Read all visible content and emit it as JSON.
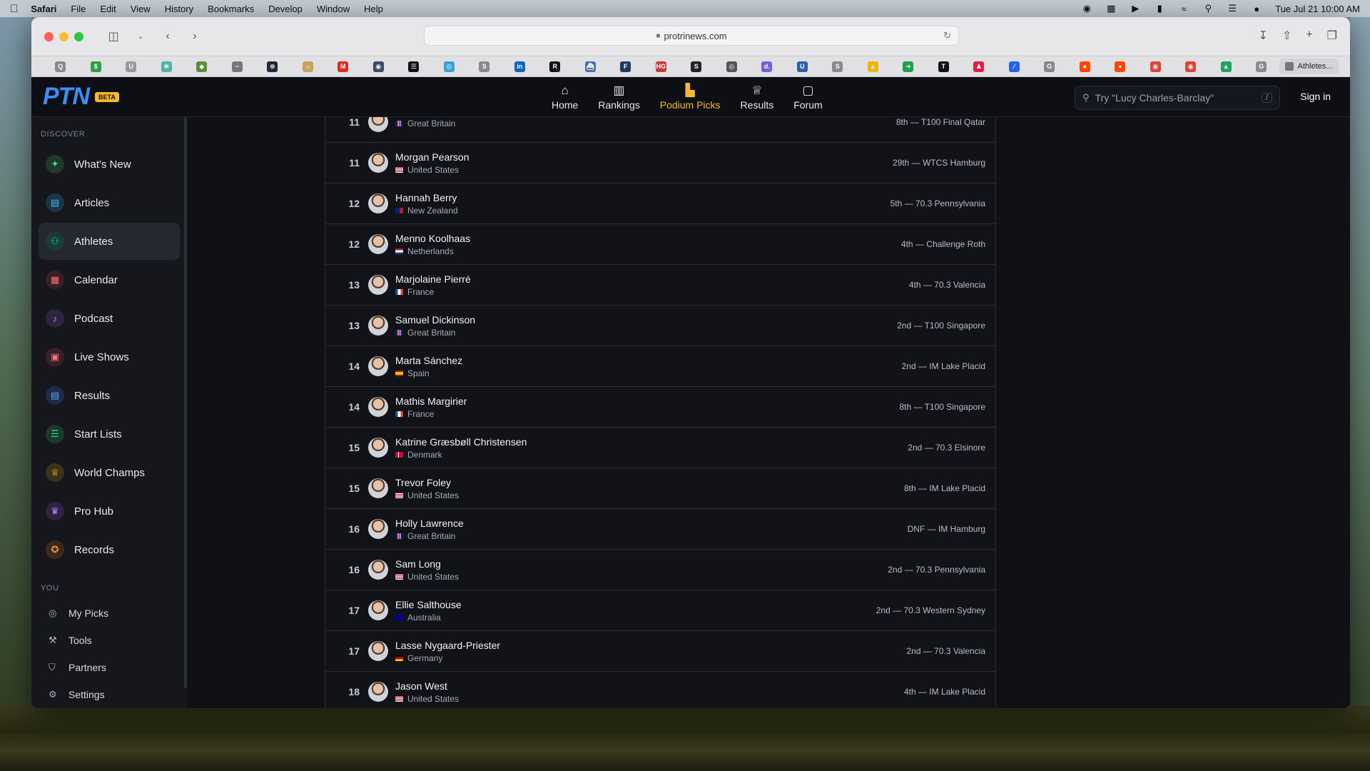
{
  "menubar": {
    "app": "Safari",
    "items": [
      "File",
      "Edit",
      "View",
      "History",
      "Bookmarks",
      "Develop",
      "Window",
      "Help"
    ],
    "clock": "Tue Jul 21  10:00 AM"
  },
  "browser": {
    "url": "protrinews.com",
    "tab_title": "Athletes...",
    "favorites": [
      {
        "icon": "q-icon",
        "glyph": "Q",
        "color": "#8a8a8a"
      },
      {
        "icon": "dollar-icon",
        "glyph": "$",
        "color": "#2e9e47"
      },
      {
        "icon": "u-icon",
        "glyph": "U",
        "color": "#9a9a9a"
      },
      {
        "icon": "tree-icon",
        "glyph": "✱",
        "color": "#4fb3a9"
      },
      {
        "icon": "cube-icon",
        "glyph": "◆",
        "color": "#5a8f3a"
      },
      {
        "icon": "minus-icon",
        "glyph": "−",
        "color": "#777777"
      },
      {
        "icon": "openai-icon",
        "glyph": "⊛",
        "color": "#1f2937"
      },
      {
        "icon": "sun-icon",
        "glyph": "☼",
        "color": "#c9a35a"
      },
      {
        "icon": "gmail-icon",
        "glyph": "M",
        "color": "#d93025"
      },
      {
        "icon": "shield-icon",
        "glyph": "◉",
        "color": "#3b4a6b"
      },
      {
        "icon": "notion-icon",
        "glyph": "☰",
        "color": "#111111"
      },
      {
        "icon": "globe-icon",
        "glyph": "◎",
        "color": "#3ba0d8"
      },
      {
        "icon": "s-icon",
        "glyph": "S",
        "color": "#8a8a8a"
      },
      {
        "icon": "linkedin-icon",
        "glyph": "in",
        "color": "#0a66c2"
      },
      {
        "icon": "r-icon",
        "glyph": "R",
        "color": "#111111"
      },
      {
        "icon": "ship-icon",
        "glyph": "⛴",
        "color": "#4a6fa5"
      },
      {
        "icon": "f-icon",
        "glyph": "F",
        "color": "#1e3a5f"
      },
      {
        "icon": "hg-icon",
        "glyph": "HG",
        "color": "#c83a3a"
      },
      {
        "icon": "s-box-icon",
        "glyph": "S",
        "color": "#222222"
      },
      {
        "icon": "ring-icon",
        "glyph": "◎",
        "color": "#555555"
      },
      {
        "icon": "d-icon",
        "glyph": "d.",
        "color": "#7b5bd6"
      },
      {
        "icon": "u-box-icon",
        "glyph": "U",
        "color": "#2b5fa8"
      },
      {
        "icon": "s-gray-icon",
        "glyph": "S",
        "color": "#8a8a8a"
      },
      {
        "icon": "drive-icon",
        "glyph": "▲",
        "color": "#f2b400"
      },
      {
        "icon": "arrow-icon",
        "glyph": "➜",
        "color": "#16a34a"
      },
      {
        "icon": "tp-icon",
        "glyph": "T",
        "color": "#111111"
      },
      {
        "icon": "person-icon",
        "glyph": "♟",
        "color": "#e11d48"
      },
      {
        "icon": "swoosh-icon",
        "glyph": "⁄",
        "color": "#2563eb"
      },
      {
        "icon": "g-gray-icon",
        "glyph": "G",
        "color": "#8a8a8a"
      },
      {
        "icon": "reddit-icon",
        "glyph": "●",
        "color": "#ff4500"
      },
      {
        "icon": "reddit-alt-icon",
        "glyph": "●",
        "color": "#ff4500"
      },
      {
        "icon": "chrome-icon",
        "glyph": "◉",
        "color": "#db4437"
      },
      {
        "icon": "chrome-alt-icon",
        "glyph": "◉",
        "color": "#db4437"
      },
      {
        "icon": "drive-alt-icon",
        "glyph": "▲",
        "color": "#1fa463"
      },
      {
        "icon": "g-box-icon",
        "glyph": "G",
        "color": "#8a8a8a"
      }
    ]
  },
  "site": {
    "logo": "PTN",
    "beta": "BETA",
    "nav": [
      {
        "label": "Home",
        "icon": "home-icon",
        "glyph": "⌂",
        "active": false
      },
      {
        "label": "Rankings",
        "icon": "bar-chart-icon",
        "glyph": "▥",
        "active": false
      },
      {
        "label": "Podium Picks",
        "icon": "podium-icon",
        "glyph": "▙",
        "active": true
      },
      {
        "label": "Results",
        "icon": "trophy-icon",
        "glyph": "♕",
        "active": false
      },
      {
        "label": "Forum",
        "icon": "chat-icon",
        "glyph": "▢",
        "active": false
      }
    ],
    "search_placeholder": "Try \"Lucy Charles-Barclay\"",
    "search_shortcut": "/",
    "sign_in": "Sign in"
  },
  "sidebar": {
    "discover_label": "DISCOVER",
    "items": [
      {
        "label": "What's New",
        "icon": "sparkle-icon",
        "glyph": "✦",
        "bg": "#1f3a2a",
        "fg": "#4ade80",
        "active": false
      },
      {
        "label": "Articles",
        "icon": "article-icon",
        "glyph": "▤",
        "bg": "#1d3446",
        "fg": "#38bdf8",
        "active": false
      },
      {
        "label": "Athletes",
        "icon": "people-icon",
        "glyph": "⚇",
        "bg": "#1b3b38",
        "fg": "#2dd4bf",
        "active": true
      },
      {
        "label": "Calendar",
        "icon": "calendar-icon",
        "glyph": "▦",
        "bg": "#3b1f24",
        "fg": "#f87171",
        "active": false
      },
      {
        "label": "Podcast",
        "icon": "microphone-icon",
        "glyph": "♪",
        "bg": "#2c2440",
        "fg": "#a78bfa",
        "active": false
      },
      {
        "label": "Live Shows",
        "icon": "ticket-icon",
        "glyph": "▣",
        "bg": "#3b1f26",
        "fg": "#fb7185",
        "active": false
      },
      {
        "label": "Results",
        "icon": "clipboard-icon",
        "glyph": "▤",
        "bg": "#1e2c48",
        "fg": "#60a5fa",
        "active": false
      },
      {
        "label": "Start Lists",
        "icon": "checklist-icon",
        "glyph": "☰",
        "bg": "#1b3a2c",
        "fg": "#34d399",
        "active": false
      },
      {
        "label": "World Champs",
        "icon": "trophy-icon",
        "glyph": "♕",
        "bg": "#3a331b",
        "fg": "#facc15",
        "active": false
      },
      {
        "label": "Pro Hub",
        "icon": "crown-icon",
        "glyph": "♛",
        "bg": "#2e2442",
        "fg": "#c084fc",
        "active": false
      },
      {
        "label": "Records",
        "icon": "medal-icon",
        "glyph": "✪",
        "bg": "#3b2a1b",
        "fg": "#fb923c",
        "active": false
      }
    ],
    "you_label": "YOU",
    "small_items": [
      {
        "label": "My Picks",
        "icon": "target-icon",
        "glyph": "◎"
      },
      {
        "label": "Tools",
        "icon": "wrench-icon",
        "glyph": "⚒"
      },
      {
        "label": "Partners",
        "icon": "badge-icon",
        "glyph": "⛉"
      },
      {
        "label": "Settings",
        "icon": "gear-icon",
        "glyph": "⚙"
      }
    ]
  },
  "athletes": [
    {
      "rank": "11",
      "name": "",
      "country": "Great Britain",
      "flag": "gb",
      "result": "8th — T100 Final Qatar"
    },
    {
      "rank": "11",
      "name": "Morgan Pearson",
      "country": "United States",
      "flag": "us",
      "result": "29th — WTCS Hamburg"
    },
    {
      "rank": "12",
      "name": "Hannah Berry",
      "country": "New Zealand",
      "flag": "nz",
      "result": "5th — 70.3 Pennsylvania"
    },
    {
      "rank": "12",
      "name": "Menno Koolhaas",
      "country": "Netherlands",
      "flag": "nl",
      "result": "4th — Challenge Roth"
    },
    {
      "rank": "13",
      "name": "Marjolaine Pierré",
      "country": "France",
      "flag": "fr",
      "result": "4th — 70.3 Valencia"
    },
    {
      "rank": "13",
      "name": "Samuel Dickinson",
      "country": "Great Britain",
      "flag": "gb",
      "result": "2nd — T100 Singapore"
    },
    {
      "rank": "14",
      "name": "Marta Sánchez",
      "country": "Spain",
      "flag": "es",
      "result": "2nd — IM Lake Placid"
    },
    {
      "rank": "14",
      "name": "Mathis Margirier",
      "country": "France",
      "flag": "fr",
      "result": "8th — T100 Singapore"
    },
    {
      "rank": "15",
      "name": "Katrine Græsbøll Christensen",
      "country": "Denmark",
      "flag": "dk",
      "result": "2nd — 70.3 Elsinore"
    },
    {
      "rank": "15",
      "name": "Trevor Foley",
      "country": "United States",
      "flag": "us",
      "result": "8th — IM Lake Placid"
    },
    {
      "rank": "16",
      "name": "Holly Lawrence",
      "country": "Great Britain",
      "flag": "gb",
      "result": "DNF — IM Hamburg"
    },
    {
      "rank": "16",
      "name": "Sam Long",
      "country": "United States",
      "flag": "us",
      "result": "2nd — 70.3 Pennsylvania"
    },
    {
      "rank": "17",
      "name": "Ellie Salthouse",
      "country": "Australia",
      "flag": "au",
      "result": "2nd — 70.3 Western Sydney"
    },
    {
      "rank": "17",
      "name": "Lasse Nygaard-Priester",
      "country": "Germany",
      "flag": "de",
      "result": "2nd — 70.3 Valencia"
    },
    {
      "rank": "18",
      "name": "Jason West",
      "country": "United States",
      "flag": "us",
      "result": "4th — IM Lake Placid"
    }
  ]
}
